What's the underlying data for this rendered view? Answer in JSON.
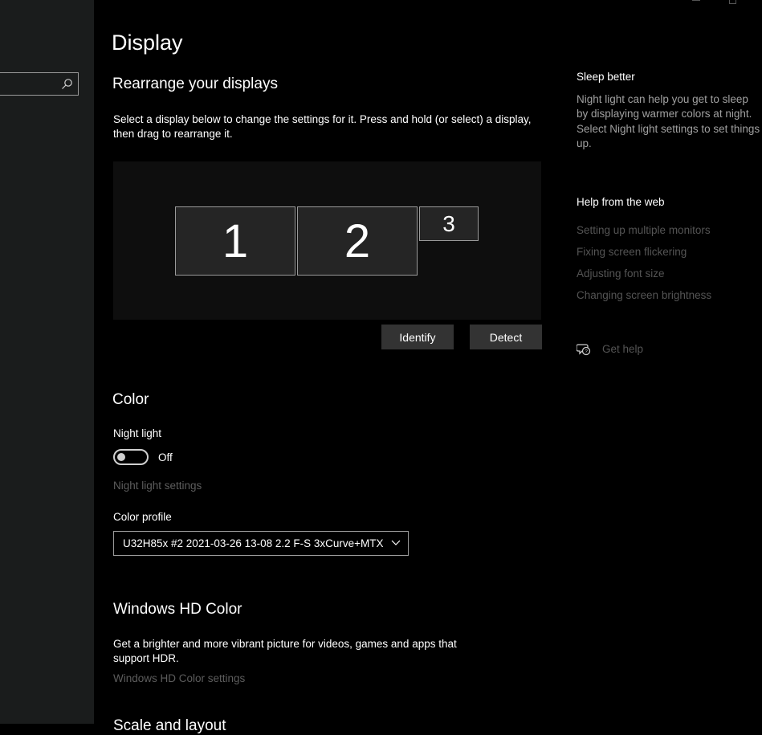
{
  "sidebar": {
    "search": {
      "value": "",
      "icon": "search-icon"
    }
  },
  "page": {
    "title": "Display"
  },
  "rearrange": {
    "title": "Rearrange your displays",
    "description_line1": "Select a display below to change the settings for it. Press and hold (or select) a display,",
    "description_line2": "then drag to rearrange it.",
    "monitors": [
      "1",
      "2",
      "3"
    ],
    "identify_label": "Identify",
    "detect_label": "Detect"
  },
  "color": {
    "title": "Color",
    "night_light_label": "Night light",
    "night_light_state": "Off",
    "night_light_settings": "Night light settings",
    "color_profile_label": "Color profile",
    "color_profile_value": "U32H85x #2 2021-03-26 13-08 2.2 F-S 3xCurve+MTX"
  },
  "hdr": {
    "title": "Windows HD Color",
    "description_line1": "Get a brighter and more vibrant picture for videos, games and apps that",
    "description_line2": "support HDR.",
    "settings_link": "Windows HD Color settings",
    "next_section_partial": "Scale and layout"
  },
  "right": {
    "sleep_title": "Sleep better",
    "sleep_line1": "Night light can help you get to sleep",
    "sleep_line2": "by displaying warmer colors at night.",
    "sleep_line3": "Select Night light settings to set things",
    "sleep_line4": "up.",
    "help_title": "Help from the web",
    "links": [
      "Setting up multiple monitors",
      "Fixing screen flickering",
      "Adjusting font size",
      "Changing screen brightness"
    ],
    "get_help": "Get help",
    "get_help_icon": "chat-help-icon"
  },
  "colors": {
    "background": "#000000",
    "sidebar": "#1a1c1c",
    "monitor_fill": "#252525",
    "button": "#333333",
    "disabled_link": "#5d5d5d"
  }
}
